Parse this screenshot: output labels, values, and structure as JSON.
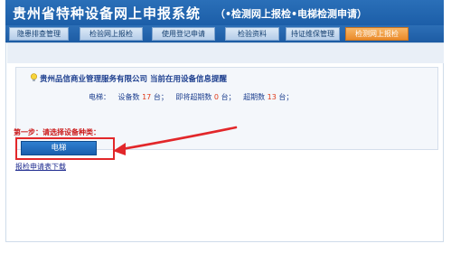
{
  "app": {
    "title": "贵州省特种设备网上申报系统",
    "subtitle": "（•检测网上报检•电梯检测申请）"
  },
  "nav": {
    "tabs": [
      {
        "label": "隐患排查管理"
      },
      {
        "label": "检验网上报检"
      },
      {
        "label": "使用登记申请"
      },
      {
        "label": "检验资料"
      },
      {
        "label": "持证维保管理"
      },
      {
        "label": "检测网上报检"
      }
    ],
    "active_index": 5
  },
  "notice": {
    "icon": "lightbulb-icon",
    "heading": "贵州品信商业管理服务有限公司  当前在用设备信息提醒",
    "equipment_label": "电梯：",
    "count_label": "设备数",
    "count_value": "17",
    "count_unit": "台；",
    "due_soon_label": "即将超期数",
    "due_soon_value": "0",
    "due_soon_unit": "台；",
    "overdue_label": "超期数",
    "overdue_value": "13",
    "overdue_unit": "台；"
  },
  "step": {
    "label": "第一步：请选择设备种类：",
    "equipment_button": "电梯",
    "download_link": "报检申请表下载"
  },
  "colors": {
    "header_blue": "#1c5ea8",
    "active_tab_orange": "#e98a2a",
    "highlight_red": "#e2272a",
    "number_red": "#e03a1a"
  }
}
